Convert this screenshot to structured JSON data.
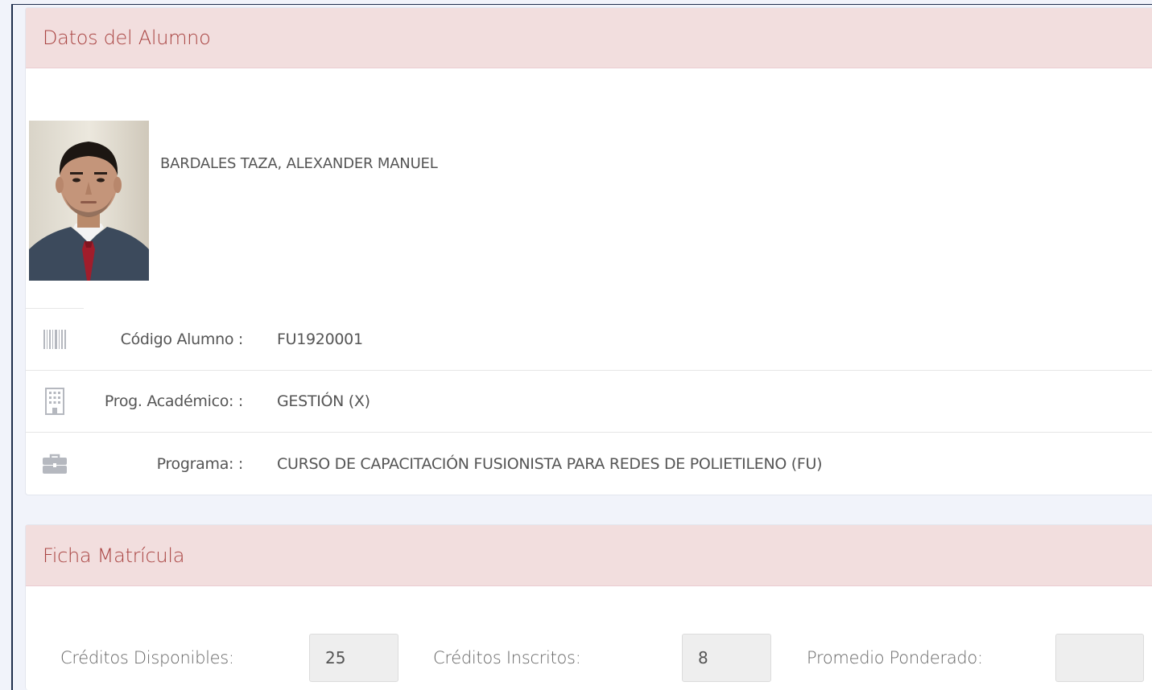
{
  "student_panel": {
    "title": "Datos del Alumno",
    "student_name": "BARDALES TAZA, ALEXANDER MANUEL",
    "rows": [
      {
        "icon": "barcode-icon",
        "label": "Código Alumno :",
        "value": "FU1920001"
      },
      {
        "icon": "building-icon",
        "label": "Prog. Académico: :",
        "value": "GESTIÓN (X)"
      },
      {
        "icon": "briefcase-icon",
        "label": "Programa: :",
        "value": "CURSO DE CAPACITACIÓN FUSIONISTA PARA REDES DE POLIETILENO (FU)"
      }
    ]
  },
  "enrollment_panel": {
    "title": "Ficha Matrícula",
    "creditos_disponibles_label": "Créditos Disponibles:",
    "creditos_disponibles_value": "25",
    "creditos_inscritos_label": "Créditos Inscritos:",
    "creditos_inscritos_value": "8",
    "promedio_label": "Promedio Ponderado:",
    "promedio_value": ""
  },
  "colors": {
    "panel_header_bg": "#f2dede",
    "panel_header_text": "#a94442",
    "icon_gray": "#b5b8bf"
  }
}
